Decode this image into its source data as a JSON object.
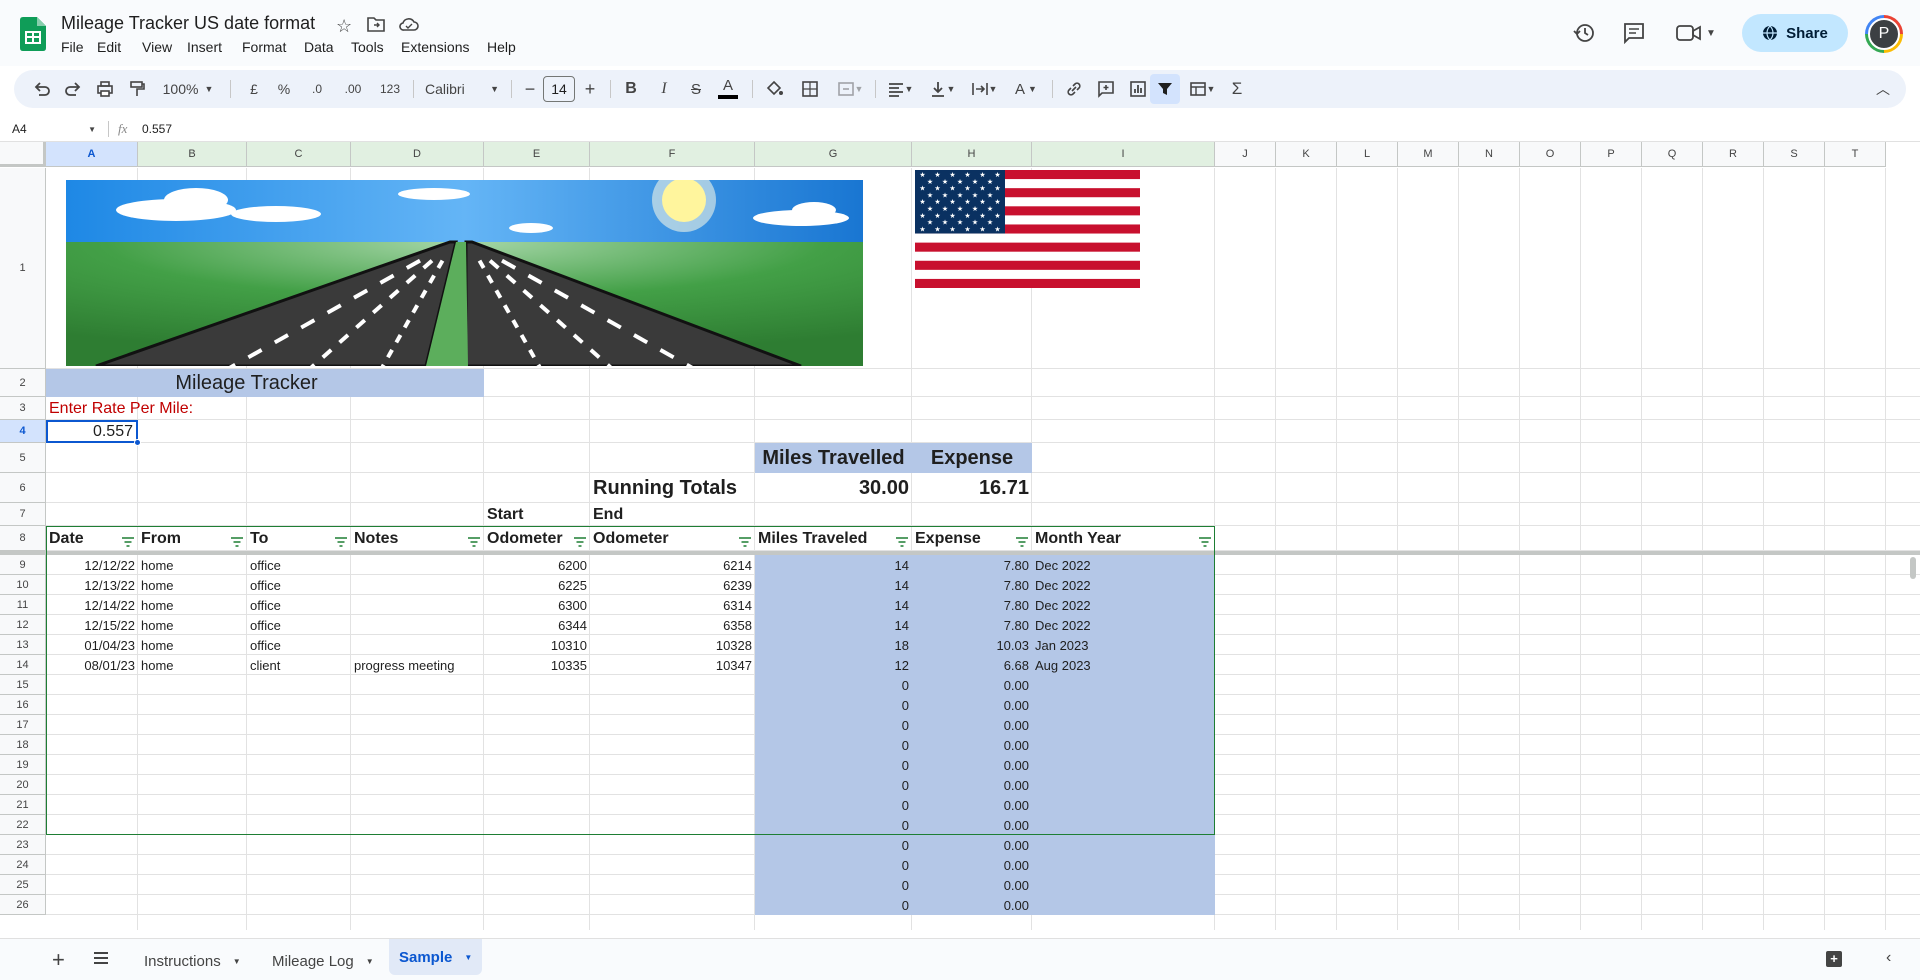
{
  "doc": {
    "title": "Mileage Tracker US date format",
    "share_label": "Share",
    "avatar_letter": "P"
  },
  "menu": [
    "File",
    "Edit",
    "View",
    "Insert",
    "Format",
    "Data",
    "Tools",
    "Extensions",
    "Help"
  ],
  "toolbar": {
    "zoom": "100%",
    "currency": "£",
    "percent": "%",
    "dec_less": ".0",
    "dec_more": ".00",
    "number_fmt": "123",
    "font": "Calibri",
    "font_size": "14"
  },
  "formula_bar": {
    "name_box": "A4",
    "fx": "fx",
    "value": "0.557"
  },
  "columns": [
    "A",
    "B",
    "C",
    "D",
    "E",
    "F",
    "G",
    "H",
    "I",
    "J",
    "K",
    "L",
    "M",
    "N",
    "O",
    "P",
    "Q",
    "R",
    "S",
    "T"
  ],
  "rows": [
    "1",
    "2",
    "3",
    "4",
    "5",
    "6",
    "7",
    "8",
    "9",
    "10",
    "11",
    "12",
    "13",
    "14",
    "15",
    "16",
    "17",
    "18",
    "19",
    "20",
    "21",
    "22",
    "23",
    "24",
    "25",
    "26"
  ],
  "sheet": {
    "title": "Mileage Tracker",
    "rate_label": "Enter Rate Per Mile:",
    "rate_value": "0.557",
    "summary_headers": {
      "miles": "Miles Travelled",
      "expense": "Expense"
    },
    "running_totals_label": "Running Totals",
    "running_miles": "30.00",
    "running_expense": "16.71",
    "start_label": "Start",
    "end_label": "End",
    "headers": [
      "Date",
      "From",
      "To",
      "Notes",
      "Odometer",
      "Odometer",
      "Miles Traveled",
      "Expense",
      "Month Year"
    ],
    "data_rows": [
      [
        "12/12/22",
        "home",
        "office",
        "",
        "6200",
        "6214",
        "14",
        "7.80",
        "Dec 2022"
      ],
      [
        "12/13/22",
        "home",
        "office",
        "",
        "6225",
        "6239",
        "14",
        "7.80",
        "Dec 2022"
      ],
      [
        "12/14/22",
        "home",
        "office",
        "",
        "6300",
        "6314",
        "14",
        "7.80",
        "Dec 2022"
      ],
      [
        "12/15/22",
        "home",
        "office",
        "",
        "6344",
        "6358",
        "14",
        "7.80",
        "Dec 2022"
      ],
      [
        "01/04/23",
        "home",
        "office",
        "",
        "10310",
        "10328",
        "18",
        "10.03",
        "Jan 2023"
      ],
      [
        "08/01/23",
        "home",
        "client",
        "progress meeting",
        "10335",
        "10347",
        "12",
        "6.68",
        "Aug 2023"
      ],
      [
        "",
        "",
        "",
        "",
        "",
        "",
        "0",
        "0.00",
        ""
      ],
      [
        "",
        "",
        "",
        "",
        "",
        "",
        "0",
        "0.00",
        ""
      ],
      [
        "",
        "",
        "",
        "",
        "",
        "",
        "0",
        "0.00",
        ""
      ],
      [
        "",
        "",
        "",
        "",
        "",
        "",
        "0",
        "0.00",
        ""
      ],
      [
        "",
        "",
        "",
        "",
        "",
        "",
        "0",
        "0.00",
        ""
      ],
      [
        "",
        "",
        "",
        "",
        "",
        "",
        "0",
        "0.00",
        ""
      ],
      [
        "",
        "",
        "",
        "",
        "",
        "",
        "0",
        "0.00",
        ""
      ],
      [
        "",
        "",
        "",
        "",
        "",
        "",
        "0",
        "0.00",
        ""
      ],
      [
        "",
        "",
        "",
        "",
        "",
        "",
        "0",
        "0.00",
        ""
      ],
      [
        "",
        "",
        "",
        "",
        "",
        "",
        "0",
        "0.00",
        ""
      ],
      [
        "",
        "",
        "",
        "",
        "",
        "",
        "0",
        "0.00",
        ""
      ],
      [
        "",
        "",
        "",
        "",
        "",
        "",
        "0",
        "0.00",
        ""
      ]
    ]
  },
  "tabs": {
    "items": [
      "Instructions",
      "Mileage Log",
      "Sample"
    ],
    "active": "Sample"
  },
  "colors": {
    "accent": "#0b57d0",
    "highlight": "#b4c7e7",
    "rate_red": "#c00000",
    "share_bg": "#c2e7ff"
  }
}
